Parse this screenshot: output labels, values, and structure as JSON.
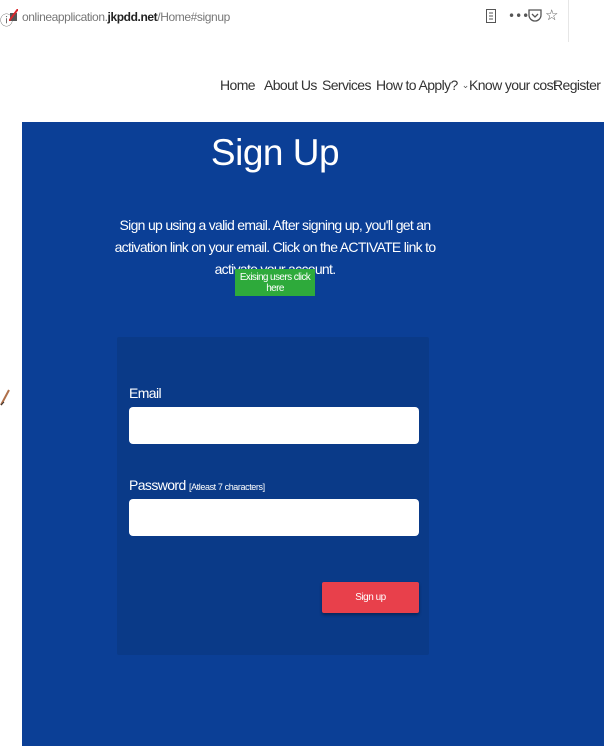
{
  "browser": {
    "url_prefix": "onlineapplication.",
    "url_domain": "jkpdd.net",
    "url_path": "/Home#signup",
    "reader_icon": "reader-view-icon",
    "menu_icon": "more-actions-icon",
    "pocket_icon": "pocket-icon",
    "star_icon": "bookmark-star-icon"
  },
  "nav": {
    "items": [
      {
        "label": "Home"
      },
      {
        "label": "About Us"
      },
      {
        "label": "Services"
      },
      {
        "label": "How to Apply?",
        "dropdown": true
      },
      {
        "label": "Know your cost"
      },
      {
        "label": "Register",
        "dropdown": true
      }
    ]
  },
  "hero": {
    "title": "Sign Up",
    "description": "Sign up using a valid email. After signing up, you'll get an activation link on your email. Click on the ACTIVATE link to activate your account.",
    "existing_button": "Exising users click here"
  },
  "form": {
    "email_label": "Email",
    "email_value": "",
    "password_label": "Password",
    "password_hint": "[Atleast 7 characters]",
    "password_value": "",
    "submit_label": "Sign up"
  },
  "colors": {
    "hero_bg": "#0b3f96",
    "panel_bg": "#0a3a88",
    "existing_button": "#2eaa3b",
    "signup_button": "#e8404b"
  }
}
